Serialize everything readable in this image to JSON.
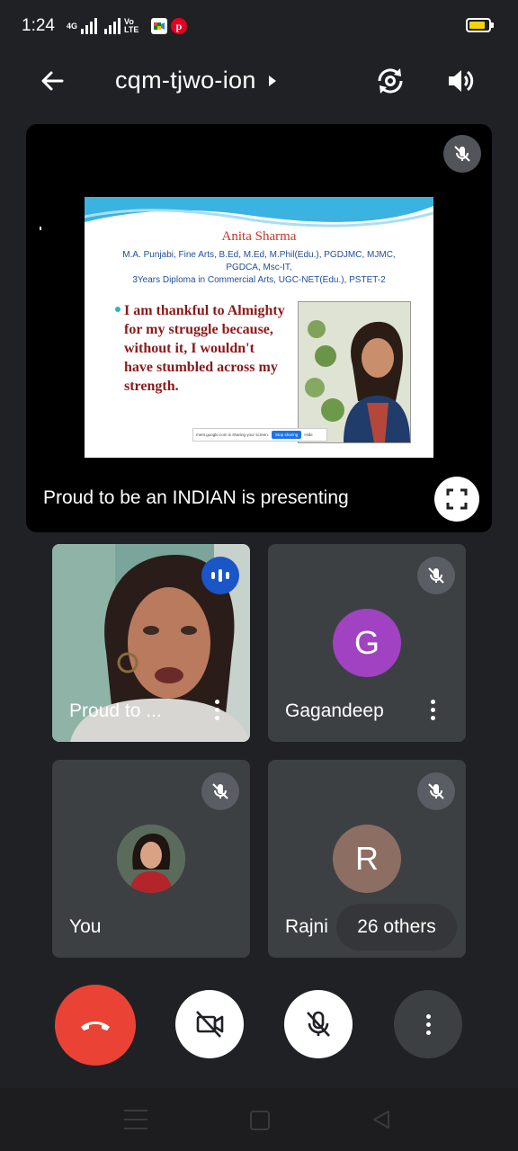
{
  "status_bar": {
    "time": "1:24",
    "network_label_1": "4G",
    "network_label_2": "Vo LTE",
    "battery_color": "#f5d10b"
  },
  "header": {
    "back_icon": "arrow-left-icon",
    "meeting_code": "cqm-tjwo-ion",
    "switch_camera_icon": "switch-camera-icon",
    "speaker_icon": "volume-icon"
  },
  "presentation": {
    "presenter_label": "Proud to be an INDIAN is presenting",
    "slide": {
      "name": "Anita Sharma",
      "qualifications_line1": "M.A. Punjabi, Fine Arts, B.Ed, M.Ed, M.Phil(Edu.), PGDJMC, MJMC,",
      "qualifications_line2": "PGDCA, Msc-IT,",
      "qualifications_line3": "3Years Diploma in Commercial Arts,  UGC-NET(Edu.), PSTET-2",
      "quote": "I am thankful to Almighty for my struggle because, without it, I wouldn't have stumbled across my strength.",
      "share_text": "meet.google.com is sharing your screen.",
      "share_stop": "Stop sharing",
      "share_hide": "Hide"
    }
  },
  "participants": [
    {
      "name": "Proud to ...",
      "speaking": true
    },
    {
      "name": "Gagandeep",
      "initial": "G",
      "avatar_color": "#a142c3",
      "muted": true
    },
    {
      "name": "You",
      "muted": true
    },
    {
      "name": "Rajni",
      "initial": "R",
      "avatar_color": "#8d6e63",
      "muted": true
    }
  ],
  "others_label": "26 others",
  "controls": {
    "end_call_color": "#ea4335"
  }
}
